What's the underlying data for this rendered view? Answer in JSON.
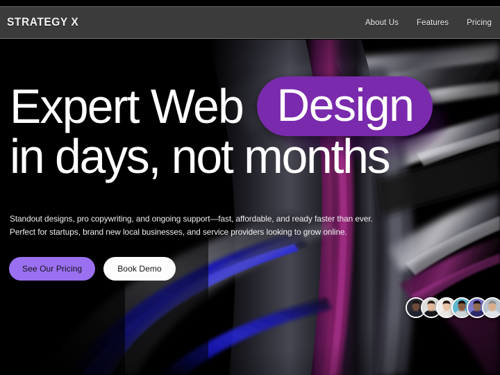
{
  "site": {
    "logo": "STRATEGY X"
  },
  "nav": {
    "items": [
      {
        "label": "About Us"
      },
      {
        "label": "Features"
      },
      {
        "label": "Pricing"
      }
    ]
  },
  "hero": {
    "headline": {
      "line1_before": "Expert Web",
      "line1_highlight": "Design",
      "line2": "in days, not months"
    },
    "subtext": {
      "line1": "Standout designs, pro copywriting, and ongoing support—fast, affordable, and ready faster than ever.",
      "line2": "Perfect for startups, brand new local businesses, and service providers looking to grow online."
    },
    "cta": {
      "primary": "See Our Pricing",
      "secondary": "Book Demo"
    },
    "avatars": [
      {
        "name": "avatar-1",
        "skin": "#6d4a3a",
        "hair": "#1b1512",
        "shirt": "#1e2430",
        "bg": "#2a2b33"
      },
      {
        "name": "avatar-2",
        "skin": "#e2b89a",
        "hair": "#2b2119",
        "shirt": "#17181b",
        "bg": "#dcdcdc"
      },
      {
        "name": "avatar-3",
        "skin": "#e8c3a6",
        "hair": "#241a14",
        "shirt": "#e9e6e2",
        "bg": "#f1efec"
      },
      {
        "name": "avatar-4",
        "skin": "#8a5c43",
        "hair": "#15100d",
        "shirt": "#cfd6da",
        "bg": "#5fb6cc"
      },
      {
        "name": "avatar-5",
        "skin": "#8f6a52",
        "hair": "#120d1e",
        "shirt": "#2d2a6b",
        "bg": "#7b77c9"
      },
      {
        "name": "avatar-6",
        "skin": "#d8ae8c",
        "hair": "#8d8d8d",
        "shirt": "#dfe3e8",
        "bg": "#b9c3cc"
      }
    ]
  },
  "colors": {
    "header_bg": "#3b3b3b",
    "page_bg": "#000000",
    "pill_purple": "#7a2aad",
    "btn_primary": "#9a70f0",
    "btn_secondary": "#fdfdfd",
    "text_white": "#ffffff",
    "accent_blue": "#1a1ad6",
    "accent_magenta": "#7d1f63",
    "accent_silver": "#d8d8dd"
  }
}
